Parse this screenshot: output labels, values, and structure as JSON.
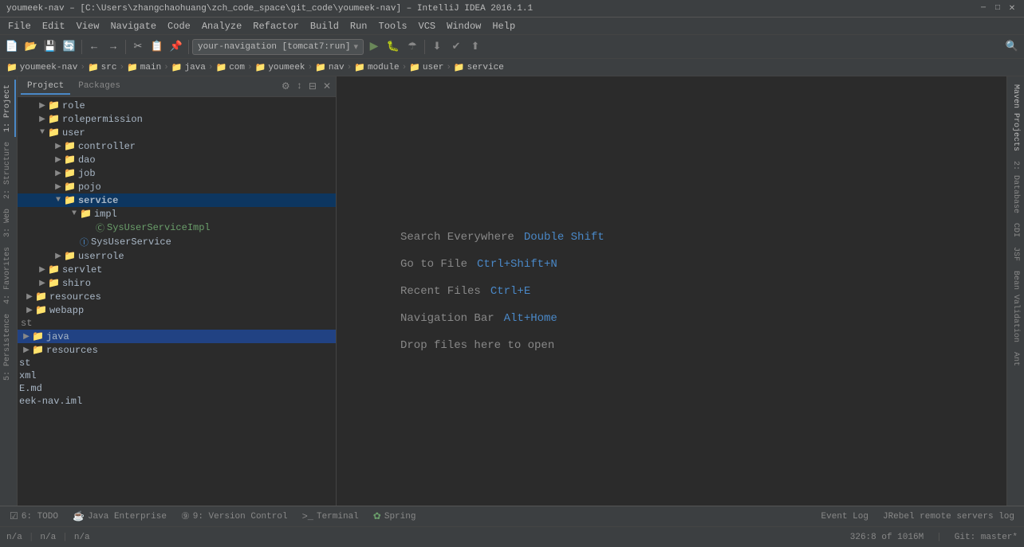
{
  "titleBar": {
    "title": "youmeek-nav – [C:\\Users\\zhangchaohuang\\zch_code_space\\git_code\\youmeek-nav] – IntelliJ IDEA 2016.1.1",
    "minimize": "─",
    "maximize": "□",
    "close": "✕"
  },
  "menuBar": {
    "items": [
      "File",
      "Edit",
      "View",
      "Navigate",
      "Code",
      "Analyze",
      "Refactor",
      "Build",
      "Run",
      "Tools",
      "VCS",
      "Window",
      "Help"
    ]
  },
  "toolbar": {
    "runConfig": "your-navigation [tomcat7:run]"
  },
  "breadcrumb": {
    "items": [
      "youmeek-nav",
      "src",
      "main",
      "java",
      "com",
      "youmeek",
      "nav",
      "module",
      "user",
      "service"
    ]
  },
  "projectPanel": {
    "tabs": [
      "Project",
      "Packages"
    ],
    "tree": [
      {
        "depth": 0,
        "type": "folder",
        "label": "role",
        "expanded": false
      },
      {
        "depth": 0,
        "type": "folder",
        "label": "rolepermission",
        "expanded": false
      },
      {
        "depth": 0,
        "type": "folder",
        "label": "user",
        "expanded": true,
        "selected": false
      },
      {
        "depth": 1,
        "type": "folder",
        "label": "controller",
        "expanded": false
      },
      {
        "depth": 1,
        "type": "folder",
        "label": "dao",
        "expanded": false
      },
      {
        "depth": 1,
        "type": "folder",
        "label": "job",
        "expanded": false
      },
      {
        "depth": 1,
        "type": "folder",
        "label": "pojo",
        "expanded": false
      },
      {
        "depth": 1,
        "type": "folder",
        "label": "service",
        "expanded": true,
        "selected": true
      },
      {
        "depth": 2,
        "type": "folder",
        "label": "impl",
        "expanded": true
      },
      {
        "depth": 3,
        "type": "java",
        "label": "SysUserServiceImpl",
        "color": "green"
      },
      {
        "depth": 2,
        "type": "java",
        "label": "SysUserService",
        "color": "blue"
      },
      {
        "depth": 1,
        "type": "folder",
        "label": "userrole",
        "expanded": false
      },
      {
        "depth": 0,
        "type": "folder",
        "label": "servlet",
        "expanded": false
      },
      {
        "depth": 0,
        "type": "folder",
        "label": "shiro",
        "expanded": false
      },
      {
        "depth": -1,
        "type": "folder",
        "label": "resources",
        "expanded": false
      },
      {
        "depth": -1,
        "type": "folder",
        "label": "webapp",
        "expanded": false
      },
      {
        "depth": -2,
        "type": "folder",
        "label": "st",
        "expanded": false
      },
      {
        "depth": -2,
        "type": "folder",
        "label": "java",
        "expanded": false,
        "highlighted": true
      },
      {
        "depth": -2,
        "type": "folder",
        "label": "resources",
        "expanded": false
      },
      {
        "depth": -3,
        "type": "text",
        "label": "st"
      },
      {
        "depth": -3,
        "type": "text",
        "label": "xml"
      },
      {
        "depth": -3,
        "type": "text",
        "label": "E.md"
      },
      {
        "depth": -3,
        "type": "text",
        "label": "eek-nav.iml"
      }
    ]
  },
  "editor": {
    "hints": [
      {
        "label": "Search Everywhere",
        "key": "Double Shift"
      },
      {
        "label": "Go to File",
        "key": "Ctrl+Shift+N"
      },
      {
        "label": "Recent Files",
        "key": "Ctrl+E"
      },
      {
        "label": "Navigation Bar",
        "key": "Alt+Home"
      }
    ],
    "dropHint": "Drop files here to open"
  },
  "rightSidebar": {
    "tabs": [
      "Maven Projects",
      "2: Database",
      "CDI",
      "JSF",
      "Bean Validation",
      "Ant"
    ]
  },
  "leftTabs": {
    "tabs": [
      "1: Project",
      "2: Structure",
      "3: Web",
      "4: Favorites",
      "5: Persistence"
    ]
  },
  "bottomTabs": {
    "tabs": [
      {
        "icon": "☑",
        "label": "6: TODO"
      },
      {
        "icon": "☕",
        "label": "Java Enterprise"
      },
      {
        "icon": "⑨",
        "label": "9: Version Control"
      },
      {
        "icon": ">_",
        "label": "Terminal"
      },
      {
        "icon": "✿",
        "label": "Spring"
      }
    ]
  },
  "statusBar": {
    "right": {
      "na1": "n/a",
      "na2": "n/a",
      "na3": "n/a",
      "position": "326:8 of 1016M",
      "branch": "Git: master*"
    },
    "eventLog": "Event Log",
    "jrebel": "JRebel remote servers log"
  }
}
